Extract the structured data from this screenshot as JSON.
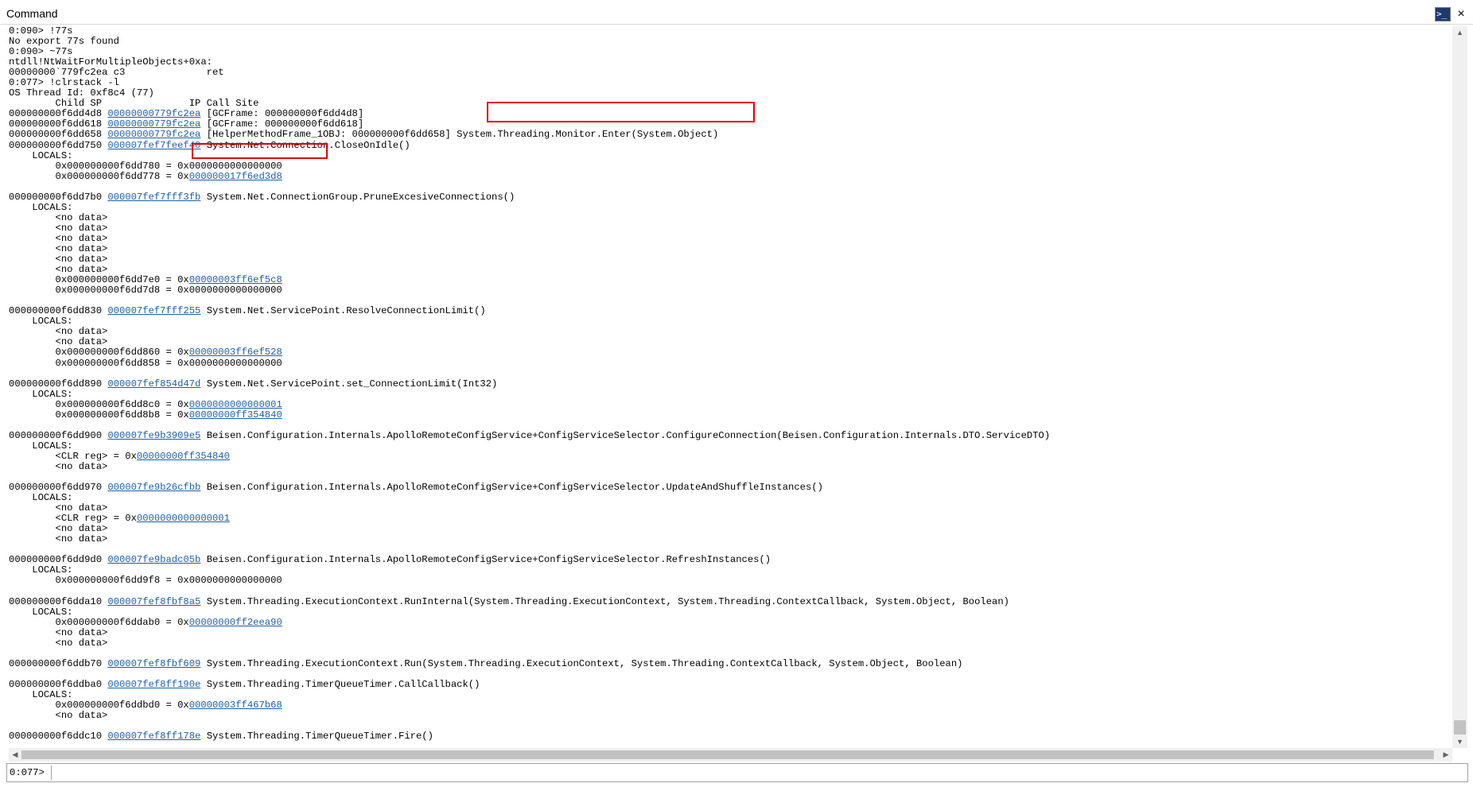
{
  "window": {
    "title": "Command"
  },
  "output_lines": [
    [
      {
        "t": "0:090> !77s"
      }
    ],
    [
      {
        "t": "No export 77s found"
      }
    ],
    [
      {
        "t": "0:090> ~77s"
      }
    ],
    [
      {
        "t": "ntdll!NtWaitForMultipleObjects+0xa:"
      }
    ],
    [
      {
        "t": "00000000`779fc2ea c3              ret"
      }
    ],
    [
      {
        "t": "0:077> !clrstack -l"
      }
    ],
    [
      {
        "t": "OS Thread Id: 0xf8c4 (77)"
      }
    ],
    [
      {
        "t": "        Child SP               IP Call Site"
      }
    ],
    [
      {
        "t": "000000000f6dd4d8 "
      },
      {
        "t": "00000000779fc2ea",
        "link": true
      },
      {
        "t": " [GCFrame: 000000000f6dd4d8]"
      }
    ],
    [
      {
        "t": "000000000f6dd618 "
      },
      {
        "t": "00000000779fc2ea",
        "link": true
      },
      {
        "t": " [GCFrame: 000000000f6dd618]"
      }
    ],
    [
      {
        "t": "000000000f6dd658 "
      },
      {
        "t": "00000000779fc2ea",
        "link": true
      },
      {
        "t": " [HelperMethodFrame_1OBJ: 000000000f6dd658] System.Threading.Monitor.Enter(System.Object)"
      }
    ],
    [
      {
        "t": "000000000f6dd750 "
      },
      {
        "t": "000007fef7feef40",
        "link": true
      },
      {
        "t": " System.Net.Connection.CloseOnIdle()"
      }
    ],
    [
      {
        "t": "    LOCALS:"
      }
    ],
    [
      {
        "t": "        0x000000000f6dd780 = 0x0000000000000000"
      }
    ],
    [
      {
        "t": "        0x000000000f6dd778 = 0x"
      },
      {
        "t": "000000017f6ed3d8",
        "link": true
      }
    ],
    [
      {
        "t": ""
      }
    ],
    [
      {
        "t": "000000000f6dd7b0 "
      },
      {
        "t": "000007fef7fff3fb",
        "link": true
      },
      {
        "t": " System.Net.ConnectionGroup.PruneExcesiveConnections()"
      }
    ],
    [
      {
        "t": "    LOCALS:"
      }
    ],
    [
      {
        "t": "        <no data>"
      }
    ],
    [
      {
        "t": "        <no data>"
      }
    ],
    [
      {
        "t": "        <no data>"
      }
    ],
    [
      {
        "t": "        <no data>"
      }
    ],
    [
      {
        "t": "        <no data>"
      }
    ],
    [
      {
        "t": "        <no data>"
      }
    ],
    [
      {
        "t": "        0x000000000f6dd7e0 = 0x"
      },
      {
        "t": "00000003ff6ef5c8",
        "link": true
      }
    ],
    [
      {
        "t": "        0x000000000f6dd7d8 = 0x0000000000000000"
      }
    ],
    [
      {
        "t": ""
      }
    ],
    [
      {
        "t": "000000000f6dd830 "
      },
      {
        "t": "000007fef7fff255",
        "link": true
      },
      {
        "t": " System.Net.ServicePoint.ResolveConnectionLimit()"
      }
    ],
    [
      {
        "t": "    LOCALS:"
      }
    ],
    [
      {
        "t": "        <no data>"
      }
    ],
    [
      {
        "t": "        <no data>"
      }
    ],
    [
      {
        "t": "        0x000000000f6dd860 = 0x"
      },
      {
        "t": "00000003ff6ef528",
        "link": true
      }
    ],
    [
      {
        "t": "        0x000000000f6dd858 = 0x0000000000000000"
      }
    ],
    [
      {
        "t": ""
      }
    ],
    [
      {
        "t": "000000000f6dd890 "
      },
      {
        "t": "000007fef854d47d",
        "link": true
      },
      {
        "t": " System.Net.ServicePoint.set_ConnectionLimit(Int32)"
      }
    ],
    [
      {
        "t": "    LOCALS:"
      }
    ],
    [
      {
        "t": "        0x000000000f6dd8c0 = 0x"
      },
      {
        "t": "0000000000000001",
        "link": true
      }
    ],
    [
      {
        "t": "        0x000000000f6dd8b8 = 0x"
      },
      {
        "t": "00000000ff354840",
        "link": true
      }
    ],
    [
      {
        "t": ""
      }
    ],
    [
      {
        "t": "000000000f6dd900 "
      },
      {
        "t": "000007fe9b3909e5",
        "link": true
      },
      {
        "t": " Beisen.Configuration.Internals.ApolloRemoteConfigService+ConfigServiceSelector.ConfigureConnection(Beisen.Configuration.Internals.DTO.ServiceDTO)"
      }
    ],
    [
      {
        "t": "    LOCALS:"
      }
    ],
    [
      {
        "t": "        <CLR reg> = 0x"
      },
      {
        "t": "00000000ff354840",
        "link": true
      }
    ],
    [
      {
        "t": "        <no data>"
      }
    ],
    [
      {
        "t": ""
      }
    ],
    [
      {
        "t": "000000000f6dd970 "
      },
      {
        "t": "000007fe9b26cfbb",
        "link": true
      },
      {
        "t": " Beisen.Configuration.Internals.ApolloRemoteConfigService+ConfigServiceSelector.UpdateAndShuffleInstances()"
      }
    ],
    [
      {
        "t": "    LOCALS:"
      }
    ],
    [
      {
        "t": "        <no data>"
      }
    ],
    [
      {
        "t": "        <CLR reg> = 0x"
      },
      {
        "t": "0000000000000001",
        "link": true
      }
    ],
    [
      {
        "t": "        <no data>"
      }
    ],
    [
      {
        "t": "        <no data>"
      }
    ],
    [
      {
        "t": ""
      }
    ],
    [
      {
        "t": "000000000f6dd9d0 "
      },
      {
        "t": "000007fe9badc05b",
        "link": true
      },
      {
        "t": " Beisen.Configuration.Internals.ApolloRemoteConfigService+ConfigServiceSelector.RefreshInstances()"
      }
    ],
    [
      {
        "t": "    LOCALS:"
      }
    ],
    [
      {
        "t": "        0x000000000f6dd9f8 = 0x0000000000000000"
      }
    ],
    [
      {
        "t": ""
      }
    ],
    [
      {
        "t": "000000000f6dda10 "
      },
      {
        "t": "000007fef8fbf8a5",
        "link": true
      },
      {
        "t": " System.Threading.ExecutionContext.RunInternal(System.Threading.ExecutionContext, System.Threading.ContextCallback, System.Object, Boolean)"
      }
    ],
    [
      {
        "t": "    LOCALS:"
      }
    ],
    [
      {
        "t": "        0x000000000f6ddab0 = 0x"
      },
      {
        "t": "00000000ff2eea90",
        "link": true
      }
    ],
    [
      {
        "t": "        <no data>"
      }
    ],
    [
      {
        "t": "        <no data>"
      }
    ],
    [
      {
        "t": ""
      }
    ],
    [
      {
        "t": "000000000f6ddb70 "
      },
      {
        "t": "000007fef8fbf609",
        "link": true
      },
      {
        "t": " System.Threading.ExecutionContext.Run(System.Threading.ExecutionContext, System.Threading.ContextCallback, System.Object, Boolean)"
      }
    ],
    [
      {
        "t": ""
      }
    ],
    [
      {
        "t": "000000000f6ddba0 "
      },
      {
        "t": "000007fef8ff190e",
        "link": true
      },
      {
        "t": " System.Threading.TimerQueueTimer.CallCallback()"
      }
    ],
    [
      {
        "t": "    LOCALS:"
      }
    ],
    [
      {
        "t": "        0x000000000f6ddbd0 = 0x"
      },
      {
        "t": "00000003ff467b68",
        "link": true
      }
    ],
    [
      {
        "t": "        <no data>"
      }
    ],
    [
      {
        "t": ""
      }
    ],
    [
      {
        "t": "000000000f6ddc10 "
      },
      {
        "t": "000007fef8ff178e",
        "link": true
      },
      {
        "t": " System.Threading.TimerQueueTimer.Fire()"
      }
    ]
  ],
  "command_bar": {
    "prompt": "0:077>",
    "value": ""
  },
  "icons": {
    "window_icon": "command-window-icon",
    "close": "close-icon",
    "scroll_up": "scroll-up-arrow-icon",
    "scroll_down": "scroll-down-arrow-icon",
    "scroll_left": "scroll-left-arrow-icon",
    "scroll_right": "scroll-right-arrow-icon"
  },
  "colors": {
    "link": "#1f5fa8",
    "highlight": "#e00000",
    "text": "#000000"
  }
}
